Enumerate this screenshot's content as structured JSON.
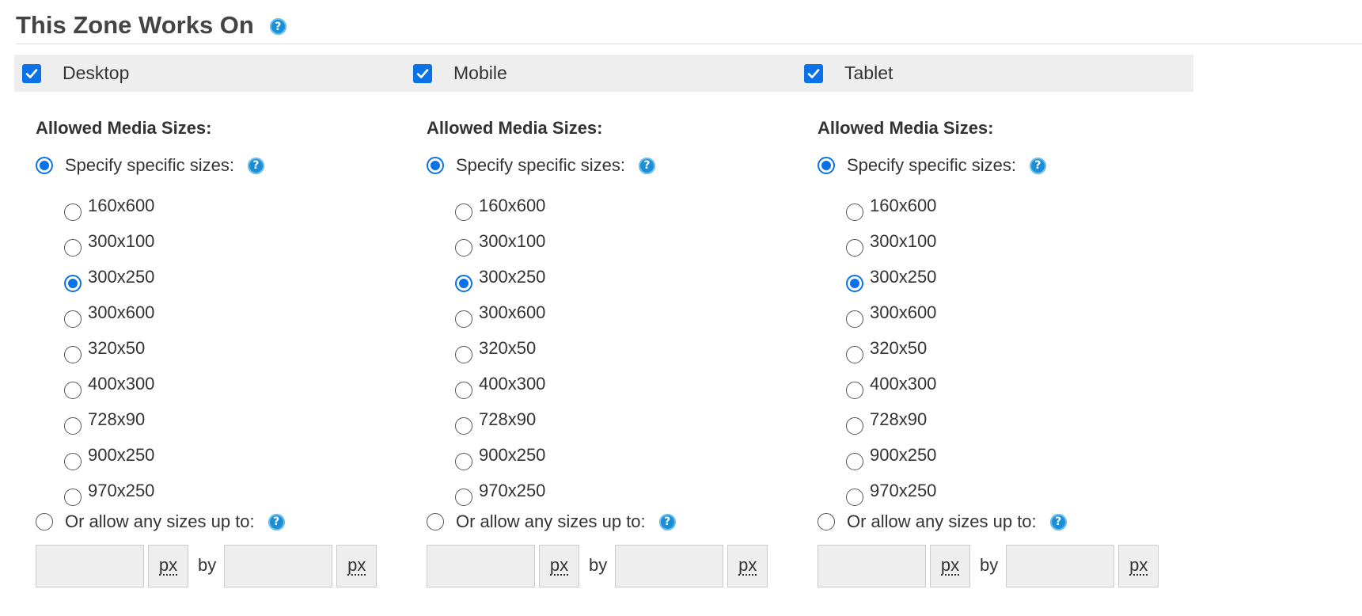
{
  "section": {
    "title": "This Zone Works On",
    "help_icon": "question-circle-icon"
  },
  "colors": {
    "accent": "#0a72e6",
    "help_icon": "#1a8fd8",
    "header_bg": "#eeeeee"
  },
  "devices": [
    {
      "label": "Desktop",
      "checked": true,
      "allowed_heading": "Allowed Media Sizes:",
      "specific_label": "Specify specific sizes:",
      "specific_selected": true,
      "sizes": [
        "160x600",
        "300x100",
        "300x250",
        "300x600",
        "320x50",
        "400x300",
        "728x90",
        "900x250",
        "970x250"
      ],
      "selected_size": "300x250",
      "any_label": "Or allow any sizes up to:",
      "any_selected": false,
      "width_value": "",
      "height_value": "",
      "px_label": "px",
      "by_label": "by"
    },
    {
      "label": "Mobile",
      "checked": true,
      "allowed_heading": "Allowed Media Sizes:",
      "specific_label": "Specify specific sizes:",
      "specific_selected": true,
      "sizes": [
        "160x600",
        "300x100",
        "300x250",
        "300x600",
        "320x50",
        "400x300",
        "728x90",
        "900x250",
        "970x250"
      ],
      "selected_size": "300x250",
      "any_label": "Or allow any sizes up to:",
      "any_selected": false,
      "width_value": "",
      "height_value": "",
      "px_label": "px",
      "by_label": "by"
    },
    {
      "label": "Tablet",
      "checked": true,
      "allowed_heading": "Allowed Media Sizes:",
      "specific_label": "Specify specific sizes:",
      "specific_selected": true,
      "sizes": [
        "160x600",
        "300x100",
        "300x250",
        "300x600",
        "320x50",
        "400x300",
        "728x90",
        "900x250",
        "970x250"
      ],
      "selected_size": "300x250",
      "any_label": "Or allow any sizes up to:",
      "any_selected": false,
      "width_value": "",
      "height_value": "",
      "px_label": "px",
      "by_label": "by"
    }
  ]
}
